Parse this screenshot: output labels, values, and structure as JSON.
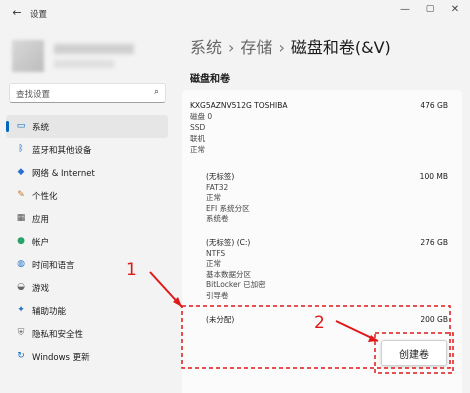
{
  "window": {
    "back_icon": "back-arrow-icon",
    "title": "设置",
    "controls": [
      "—",
      "▢",
      "✕"
    ]
  },
  "sidebar": {
    "search_placeholder": "查找设置",
    "items": [
      {
        "label": "系统",
        "icon": "monitor-icon",
        "active": true
      },
      {
        "label": "蓝牙和其他设备",
        "icon": "bluetooth-icon"
      },
      {
        "label": "网络 & Internet",
        "icon": "wifi-icon"
      },
      {
        "label": "个性化",
        "icon": "brush-icon"
      },
      {
        "label": "应用",
        "icon": "apps-icon"
      },
      {
        "label": "帐户",
        "icon": "account-icon"
      },
      {
        "label": "时间和语言",
        "icon": "globe-clock-icon"
      },
      {
        "label": "游戏",
        "icon": "gamepad-icon"
      },
      {
        "label": "辅助功能",
        "icon": "accessibility-icon"
      },
      {
        "label": "隐私和安全性",
        "icon": "shield-icon"
      },
      {
        "label": "Windows 更新",
        "icon": "update-icon"
      }
    ]
  },
  "breadcrumb": {
    "parts": [
      "系统",
      "存储",
      "磁盘和卷(&V)"
    ],
    "separator": "›"
  },
  "section_title": "磁盘和卷",
  "disk": {
    "model": "KXG5AZNV512G TOSHIBA",
    "size": "476 GB",
    "name": "磁盘 0",
    "type": "SSD",
    "status": "联机",
    "health": "正常"
  },
  "partitions": [
    {
      "label": "(无标签)",
      "size": "100 MB",
      "lines": [
        "FAT32",
        "正常",
        "EFI 系统分区",
        "系统卷"
      ]
    },
    {
      "label": "(无标签) (C:)",
      "size": "276 GB",
      "lines": [
        "NTFS",
        "正常",
        "基本数据分区",
        "BitLocker 已加密",
        "引导卷"
      ]
    },
    {
      "label": "(未分配)",
      "size": "200 GB",
      "lines": []
    }
  ],
  "create_button": "创建卷",
  "annotations": {
    "step1": "1",
    "step2": "2",
    "color": "#e01818"
  }
}
